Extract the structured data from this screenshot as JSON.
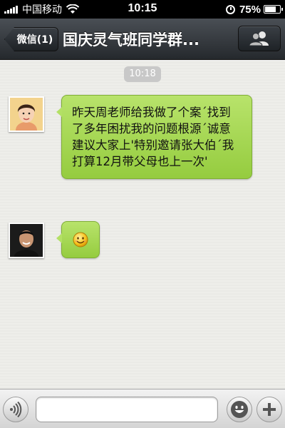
{
  "status_bar": {
    "carrier": "中国移动",
    "time": "10:15",
    "battery": "75%",
    "battery_level": 0.75
  },
  "nav": {
    "back_label": "微信(1)",
    "title": "国庆灵气班同学群..."
  },
  "chat": {
    "timestamp": "10:18",
    "messages": [
      {
        "type": "text",
        "text": "昨天周老师给我做了个案´找到了多年困扰我的问题根源´诚意建议大家上'特别邀请张大伯´我打算12月带父母也上一次'"
      },
      {
        "type": "emoji",
        "icon": "smiley-face-icon"
      }
    ]
  },
  "input_bar": {
    "placeholder": ""
  },
  "colors": {
    "bubble": "#a8da55",
    "nav": "#33383d"
  }
}
